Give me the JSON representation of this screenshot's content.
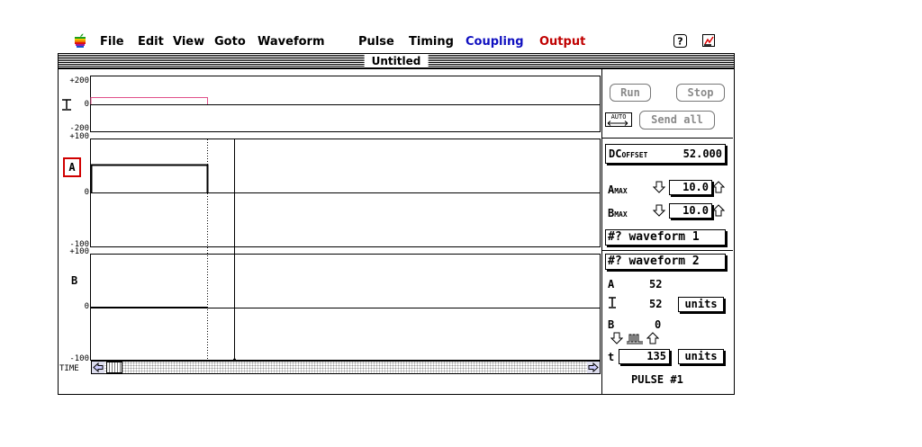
{
  "menubar": {
    "items": [
      "File",
      "Edit",
      "View",
      "Goto",
      "Waveform",
      "Pulse",
      "Timing",
      "Coupling",
      "Output"
    ],
    "colors": {
      "Coupling": "#1010c0",
      "Output": "#c00000"
    }
  },
  "window": {
    "title": "Untitled"
  },
  "top_plot": {
    "ymax": "+200",
    "ymid": "0",
    "ymin": "-200",
    "pulse_color": "#e0508a"
  },
  "plot_a": {
    "label": "A",
    "label_color": "#d00000",
    "ymax": "+100",
    "ymid": "0",
    "ymin": "-100"
  },
  "plot_b": {
    "label": "B",
    "ymax": "+100",
    "ymid": "0",
    "ymin": "-100"
  },
  "time_label": "TIME",
  "controls": {
    "run_label": "Run",
    "stop_label": "Stop",
    "auto_label": "AUTO",
    "send_all_label": "Send all",
    "dc_label": "DC",
    "dc_sub": "OFFSET",
    "dc_value": "52.000",
    "amax_label": "A",
    "amax_sub": "MAX",
    "amax_value": "10.0",
    "bmax_label": "B",
    "bmax_sub": "MAX",
    "bmax_value": "10.0",
    "waveform1_label": "#? waveform 1",
    "waveform2_label": "#? waveform 2",
    "a_label": "A",
    "a_value": "52",
    "coupled_value": "52",
    "units_label_1": "units",
    "b_label": "B",
    "b_value": "0",
    "t_label": "t",
    "t_value": "135",
    "units_label_2": "units",
    "pulse_label": "PULSE #1"
  }
}
